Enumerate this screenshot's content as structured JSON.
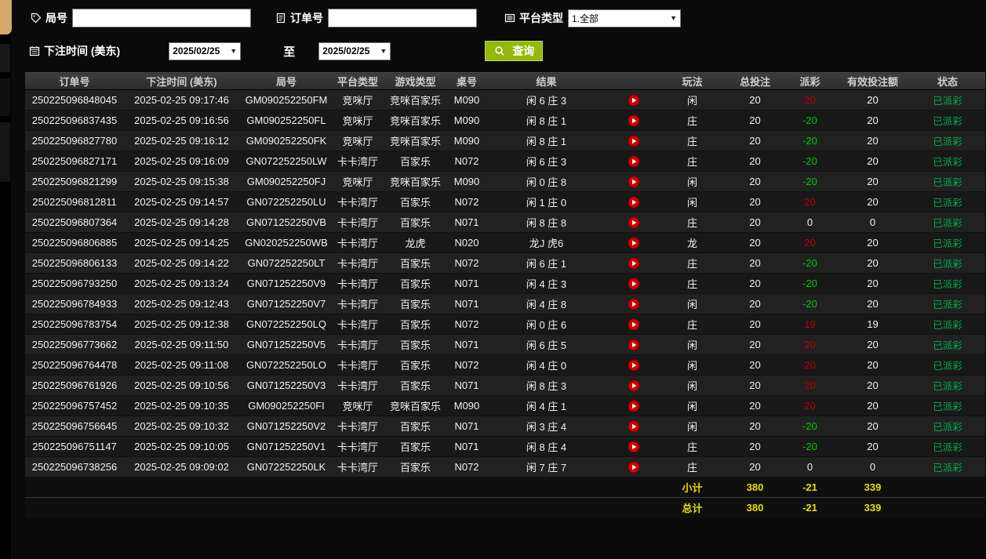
{
  "filters": {
    "round_no": {
      "label": "局号",
      "value": ""
    },
    "order_no": {
      "label": "订单号",
      "value": ""
    },
    "platform_type": {
      "label": "平台类型",
      "value": "1.全部"
    },
    "bet_time": {
      "label": "下注时间 (美东)"
    },
    "date_from": "2025/02/25",
    "to_label": "至",
    "date_to": "2025/02/25",
    "query_button": "查询"
  },
  "table": {
    "columns": [
      {
        "key": "order_no",
        "label": "订单号"
      },
      {
        "key": "bet_time",
        "label": "下注时间 (美东)"
      },
      {
        "key": "round_no",
        "label": "局号"
      },
      {
        "key": "platform",
        "label": "平台类型"
      },
      {
        "key": "game_type",
        "label": "游戏类型"
      },
      {
        "key": "table_no",
        "label": "桌号"
      },
      {
        "key": "result",
        "label": "结果"
      },
      {
        "key": "play",
        "label": ""
      },
      {
        "key": "method",
        "label": "玩法"
      },
      {
        "key": "total_bet",
        "label": "总投注"
      },
      {
        "key": "payout",
        "label": "派彩"
      },
      {
        "key": "valid_bet",
        "label": "有效投注额"
      },
      {
        "key": "status",
        "label": "状态"
      }
    ],
    "rows": [
      {
        "order_no": "250225096848045",
        "bet_time": "2025-02-25 09:17:46",
        "round_no": "GM090252250FM",
        "platform": "竞咪厅",
        "game_type": "竞咪百家乐",
        "table_no": "M090",
        "result": "闲 6 庄 3",
        "method": "闲",
        "total_bet": "20",
        "payout": "20",
        "payout_color": "win",
        "valid_bet": "20",
        "status": "已派彩"
      },
      {
        "order_no": "250225096837435",
        "bet_time": "2025-02-25 09:16:56",
        "round_no": "GM090252250FL",
        "platform": "竞咪厅",
        "game_type": "竞咪百家乐",
        "table_no": "M090",
        "result": "闲 8 庄 1",
        "method": "庄",
        "total_bet": "20",
        "payout": "-20",
        "payout_color": "loss",
        "valid_bet": "20",
        "status": "已派彩"
      },
      {
        "order_no": "250225096827780",
        "bet_time": "2025-02-25 09:16:12",
        "round_no": "GM090252250FK",
        "platform": "竞咪厅",
        "game_type": "竞咪百家乐",
        "table_no": "M090",
        "result": "闲 8 庄 1",
        "method": "庄",
        "total_bet": "20",
        "payout": "-20",
        "payout_color": "loss",
        "valid_bet": "20",
        "status": "已派彩"
      },
      {
        "order_no": "250225096827171",
        "bet_time": "2025-02-25 09:16:09",
        "round_no": "GN072252250LW",
        "platform": "卡卡湾厅",
        "game_type": "百家乐",
        "table_no": "N072",
        "result": "闲 6 庄 3",
        "method": "庄",
        "total_bet": "20",
        "payout": "-20",
        "payout_color": "loss",
        "valid_bet": "20",
        "status": "已派彩"
      },
      {
        "order_no": "250225096821299",
        "bet_time": "2025-02-25 09:15:38",
        "round_no": "GM090252250FJ",
        "platform": "竞咪厅",
        "game_type": "竞咪百家乐",
        "table_no": "M090",
        "result": "闲 0 庄 8",
        "method": "闲",
        "total_bet": "20",
        "payout": "-20",
        "payout_color": "loss",
        "valid_bet": "20",
        "status": "已派彩"
      },
      {
        "order_no": "250225096812811",
        "bet_time": "2025-02-25 09:14:57",
        "round_no": "GN072252250LU",
        "platform": "卡卡湾厅",
        "game_type": "百家乐",
        "table_no": "N072",
        "result": "闲 1 庄 0",
        "method": "闲",
        "total_bet": "20",
        "payout": "20",
        "payout_color": "win",
        "valid_bet": "20",
        "status": "已派彩"
      },
      {
        "order_no": "250225096807364",
        "bet_time": "2025-02-25 09:14:28",
        "round_no": "GN071252250VB",
        "platform": "卡卡湾厅",
        "game_type": "百家乐",
        "table_no": "N071",
        "result": "闲 8 庄 8",
        "method": "庄",
        "total_bet": "20",
        "payout": "0",
        "payout_color": "zero",
        "valid_bet": "0",
        "status": "已派彩"
      },
      {
        "order_no": "250225096806885",
        "bet_time": "2025-02-25 09:14:25",
        "round_no": "GN020252250WB",
        "platform": "卡卡湾厅",
        "game_type": "龙虎",
        "table_no": "N020",
        "result": "龙J 虎6",
        "method": "龙",
        "total_bet": "20",
        "payout": "20",
        "payout_color": "win",
        "valid_bet": "20",
        "status": "已派彩"
      },
      {
        "order_no": "250225096806133",
        "bet_time": "2025-02-25 09:14:22",
        "round_no": "GN072252250LT",
        "platform": "卡卡湾厅",
        "game_type": "百家乐",
        "table_no": "N072",
        "result": "闲 6 庄 1",
        "method": "庄",
        "total_bet": "20",
        "payout": "-20",
        "payout_color": "loss",
        "valid_bet": "20",
        "status": "已派彩"
      },
      {
        "order_no": "250225096793250",
        "bet_time": "2025-02-25 09:13:24",
        "round_no": "GN071252250V9",
        "platform": "卡卡湾厅",
        "game_type": "百家乐",
        "table_no": "N071",
        "result": "闲 4 庄 3",
        "method": "庄",
        "total_bet": "20",
        "payout": "-20",
        "payout_color": "loss",
        "valid_bet": "20",
        "status": "已派彩"
      },
      {
        "order_no": "250225096784933",
        "bet_time": "2025-02-25 09:12:43",
        "round_no": "GN071252250V7",
        "platform": "卡卡湾厅",
        "game_type": "百家乐",
        "table_no": "N071",
        "result": "闲 4 庄 8",
        "method": "闲",
        "total_bet": "20",
        "payout": "-20",
        "payout_color": "loss",
        "valid_bet": "20",
        "status": "已派彩"
      },
      {
        "order_no": "250225096783754",
        "bet_time": "2025-02-25 09:12:38",
        "round_no": "GN072252250LQ",
        "platform": "卡卡湾厅",
        "game_type": "百家乐",
        "table_no": "N072",
        "result": "闲 0 庄 6",
        "method": "庄",
        "total_bet": "20",
        "payout": "19",
        "payout_color": "win",
        "valid_bet": "19",
        "status": "已派彩"
      },
      {
        "order_no": "250225096773662",
        "bet_time": "2025-02-25 09:11:50",
        "round_no": "GN071252250V5",
        "platform": "卡卡湾厅",
        "game_type": "百家乐",
        "table_no": "N071",
        "result": "闲 6 庄 5",
        "method": "闲",
        "total_bet": "20",
        "payout": "20",
        "payout_color": "win",
        "valid_bet": "20",
        "status": "已派彩"
      },
      {
        "order_no": "250225096764478",
        "bet_time": "2025-02-25 09:11:08",
        "round_no": "GN072252250LO",
        "platform": "卡卡湾厅",
        "game_type": "百家乐",
        "table_no": "N072",
        "result": "闲 4 庄 0",
        "method": "闲",
        "total_bet": "20",
        "payout": "20",
        "payout_color": "win",
        "valid_bet": "20",
        "status": "已派彩"
      },
      {
        "order_no": "250225096761926",
        "bet_time": "2025-02-25 09:10:56",
        "round_no": "GN071252250V3",
        "platform": "卡卡湾厅",
        "game_type": "百家乐",
        "table_no": "N071",
        "result": "闲 8 庄 3",
        "method": "闲",
        "total_bet": "20",
        "payout": "20",
        "payout_color": "win",
        "valid_bet": "20",
        "status": "已派彩"
      },
      {
        "order_no": "250225096757452",
        "bet_time": "2025-02-25 09:10:35",
        "round_no": "GM090252250FI",
        "platform": "竞咪厅",
        "game_type": "竞咪百家乐",
        "table_no": "M090",
        "result": "闲 4 庄 1",
        "method": "闲",
        "total_bet": "20",
        "payout": "20",
        "payout_color": "win",
        "valid_bet": "20",
        "status": "已派彩"
      },
      {
        "order_no": "250225096756645",
        "bet_time": "2025-02-25 09:10:32",
        "round_no": "GN071252250V2",
        "platform": "卡卡湾厅",
        "game_type": "百家乐",
        "table_no": "N071",
        "result": "闲 3 庄 4",
        "method": "闲",
        "total_bet": "20",
        "payout": "-20",
        "payout_color": "loss",
        "valid_bet": "20",
        "status": "已派彩"
      },
      {
        "order_no": "250225096751147",
        "bet_time": "2025-02-25 09:10:05",
        "round_no": "GN071252250V1",
        "platform": "卡卡湾厅",
        "game_type": "百家乐",
        "table_no": "N071",
        "result": "闲 8 庄 4",
        "method": "庄",
        "total_bet": "20",
        "payout": "-20",
        "payout_color": "loss",
        "valid_bet": "20",
        "status": "已派彩"
      },
      {
        "order_no": "250225096738256",
        "bet_time": "2025-02-25 09:09:02",
        "round_no": "GN072252250LK",
        "platform": "卡卡湾厅",
        "game_type": "百家乐",
        "table_no": "N072",
        "result": "闲 7 庄 7",
        "method": "庄",
        "total_bet": "20",
        "payout": "0",
        "payout_color": "zero",
        "valid_bet": "0",
        "status": "已派彩"
      }
    ],
    "summary": [
      {
        "label": "小计",
        "total_bet": "380",
        "payout": "-21",
        "valid_bet": "339"
      },
      {
        "label": "总计",
        "total_bet": "380",
        "payout": "-21",
        "valid_bet": "339"
      }
    ]
  },
  "colors": {
    "payout_win_red": "#c00000",
    "payout_loss_green": "#00cc00",
    "status_green": "#00b050",
    "summary_yellow": "#e4e000",
    "query_button_green": "#94b80c",
    "play_button_red": "#d40000",
    "sidebar_tab_tan": "#d2a968"
  }
}
